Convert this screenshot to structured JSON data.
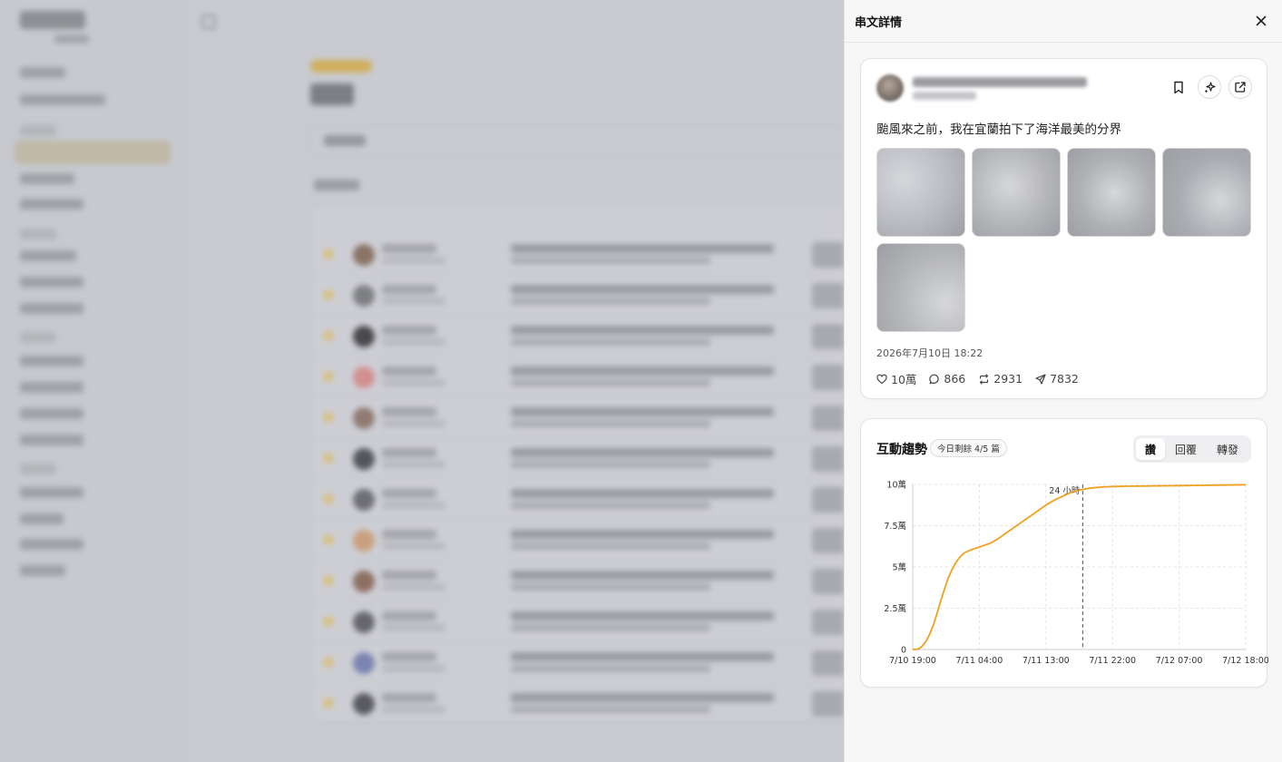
{
  "panel": {
    "title": "串文詳情"
  },
  "post": {
    "text": "颱風來之前，我在宜蘭拍下了海洋最美的分界",
    "timestamp": "2026年7月10日 18:22",
    "images": [
      {
        "tint": "#b9bbc2"
      },
      {
        "tint": "#b4b5b9"
      },
      {
        "tint": "#aeb0b4"
      },
      {
        "tint": "#a9abb0"
      },
      {
        "tint": "#b3b4b7"
      }
    ],
    "stats": {
      "likes": "10萬",
      "replies": "866",
      "reposts": "2931",
      "shares": "7832"
    }
  },
  "trend": {
    "title": "互動趨勢",
    "badge": "今日剩餘 4/5 篇",
    "tabs": [
      "讚",
      "回覆",
      "轉發"
    ],
    "active_tab": 0,
    "marker_label": "24 小時"
  },
  "chart_data": {
    "type": "line",
    "title": "",
    "xlabel": "",
    "ylabel": "",
    "x_ticks": [
      "7/10 19:00",
      "7/11 04:00",
      "7/11 13:00",
      "7/11 22:00",
      "7/12 07:00",
      "7/12 18:00"
    ],
    "y_ticks": [
      "0",
      "2.5萬",
      "5萬",
      "7.5萬",
      "10萬"
    ],
    "ylim": [
      0,
      100000
    ],
    "x_hours_range": [
      0,
      47
    ],
    "marker_x_hours": 24,
    "grid": true,
    "color": "#f0a020",
    "series": [
      {
        "name": "",
        "x_hours": [
          0,
          1,
          2,
          3,
          4,
          5,
          6,
          7,
          8,
          9,
          10,
          11,
          12,
          13,
          14,
          15,
          16,
          17,
          18,
          19,
          20,
          21,
          22,
          23,
          24,
          25,
          26,
          27,
          28,
          30,
          32,
          34,
          36,
          38,
          40,
          42,
          44,
          47
        ],
        "values": [
          0,
          800,
          6000,
          16000,
          30000,
          43000,
          52000,
          57500,
          60000,
          61500,
          63000,
          64500,
          67000,
          70000,
          73000,
          76000,
          79000,
          82000,
          85000,
          88000,
          90500,
          92500,
          94500,
          96000,
          97000,
          97700,
          98200,
          98500,
          98700,
          98900,
          99000,
          99100,
          99200,
          99300,
          99400,
          99500,
          99600,
          99800
        ]
      }
    ]
  }
}
